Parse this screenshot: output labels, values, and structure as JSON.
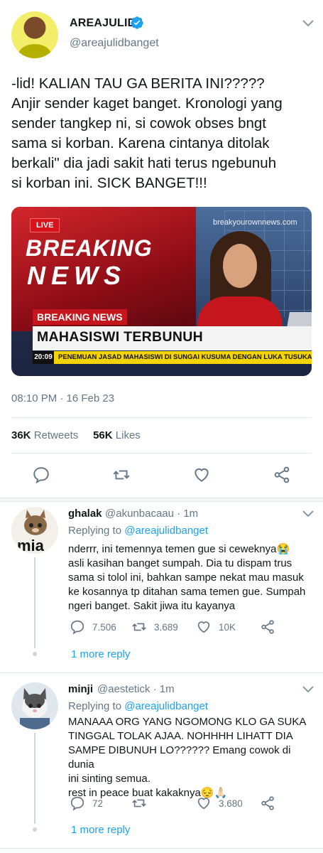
{
  "tweet": {
    "author_name": "AREAJULID",
    "author_handle": "@areajulidbanget",
    "text": "-lid! KALIAN TAU GA BERITA INI?????\nAnjir sender kaget banget. Kronologi yang\nsender tangkep ni, si cowok obses bngt\nsama si korban. Karena cintanya ditolak\nberkali\" dia jadi sakit hati terus ngebunuh\nsi korban ini. SICK BANGET!!!",
    "media": {
      "live": "LIVE",
      "breaking_line1": "BREAKING",
      "breaking_line2": "NEWS",
      "site": "breakyourownnews.com",
      "label": "BREAKING NEWS",
      "headline": "MAHASISWI TERBUNUH",
      "time": "20:09",
      "ticker": "PENEMUAN JASAD MAHASISWI DI SUNGAI KUSUMA DENGAN LUKA TUSUKAN DISEKU..."
    },
    "timestamp": "08:10 PM · 16 Feb 23",
    "retweets_count": "36K",
    "retweets_label": "Retweets",
    "likes_count": "56K",
    "likes_label": "Likes"
  },
  "replies": [
    {
      "name": "ghalak",
      "handle": "@akunbacaau · 1m",
      "replying_prefix": "Replying to",
      "replying_to": "@areajulidbanget",
      "text": "nderrr, ini temennya temen gue si ceweknya😭\nasli kasihan banget sumpah. Dia tu dispam trus\nsama si tolol ini, bahkan sampe nekat mau masuk\nke kosannya tp ditahan sama temen gue. Sumpah\nngeri banget. Sakit jiwa itu kayanya",
      "reply_count": "7.506",
      "retweet_count": "3.689",
      "like_count": "10K",
      "more": "1 more reply",
      "avatar_text": "mia"
    },
    {
      "name": "minji",
      "handle": "@aestetick · 1m",
      "replying_prefix": "Replying to",
      "replying_to": "@areajulidbanget",
      "text": "MANAAA ORG YANG NGOMONG KLO GA SUKA\nTINGGAL TOLAK AJAA. NOHHHH LIHATT DIA\nSAMPE DIBUNUH LO?????? Emang cowok di dunia\nini sinting semua.\nrest in peace buat kakaknya😔🙏🏻",
      "reply_count": "72",
      "retweet_count": "",
      "like_count": "3.680",
      "more": "1 more reply"
    }
  ],
  "colors": {
    "accent": "#1da1f2",
    "secondary_text": "#657786",
    "divider": "#e1e8ed"
  }
}
